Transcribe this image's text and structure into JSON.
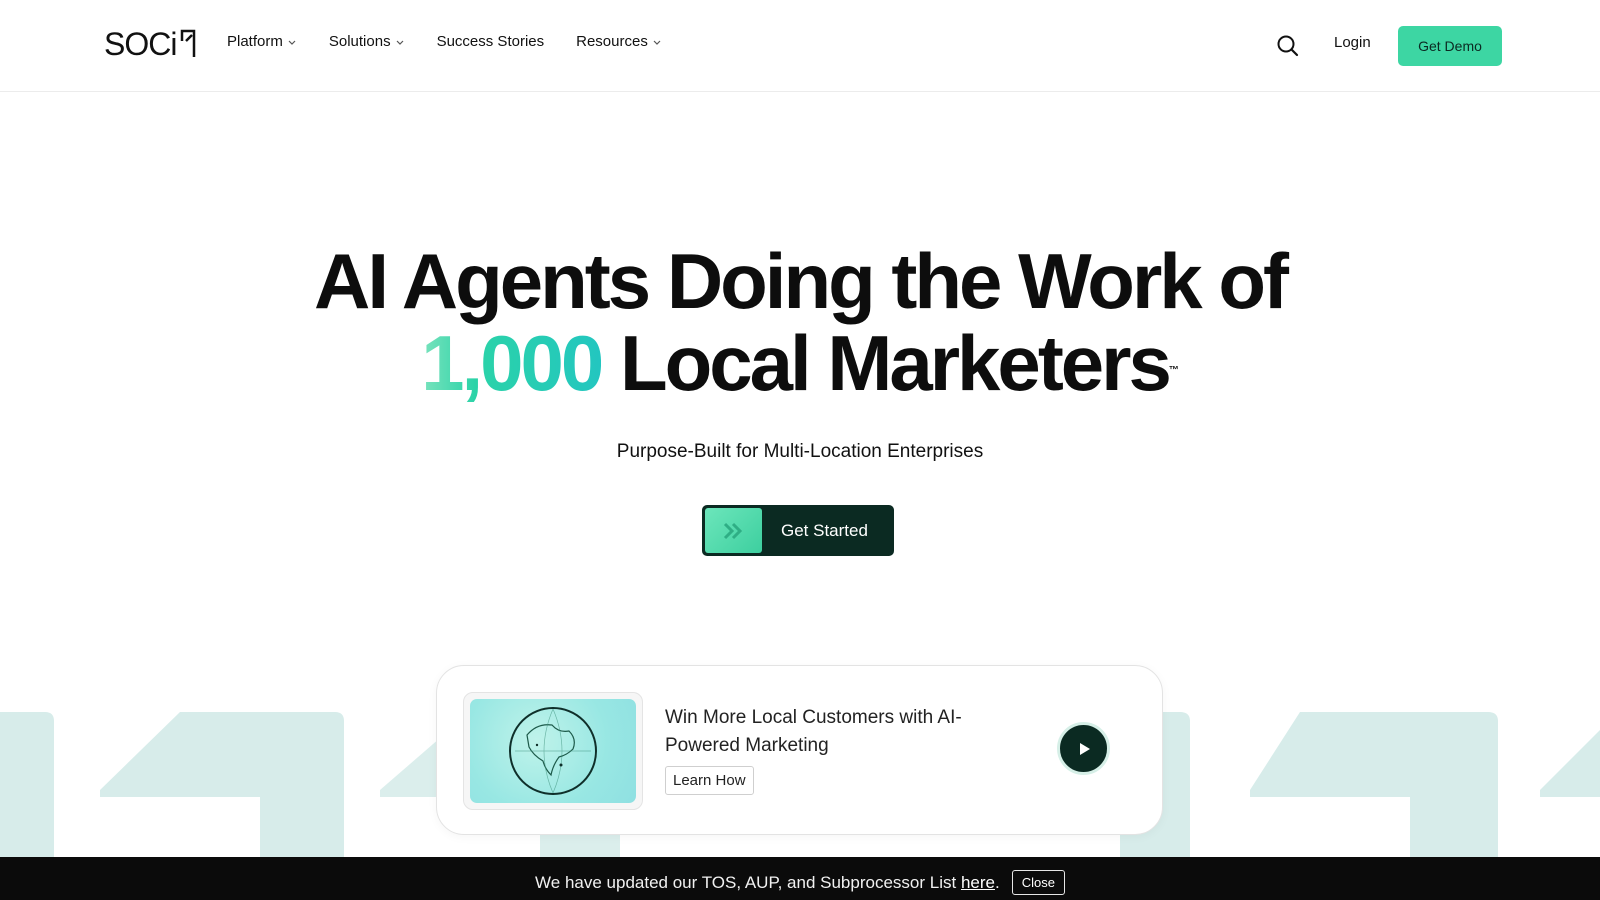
{
  "brand": {
    "logo_text": "SOCi",
    "accent_color": "#3dd6a3",
    "dark_color": "#0b2a22"
  },
  "nav": {
    "items": [
      {
        "label": "Platform",
        "has_dropdown": true
      },
      {
        "label": "Solutions",
        "has_dropdown": true
      },
      {
        "label": "Success Stories",
        "has_dropdown": false
      },
      {
        "label": "Resources",
        "has_dropdown": true
      }
    ],
    "search_icon": "search-icon",
    "login_label": "Login",
    "demo_label": "Get Demo"
  },
  "hero": {
    "title_line1": "AI Agents Doing the Work of",
    "title_accent": "1,000",
    "title_line2_rest": "Local Marketers",
    "trademark": "™",
    "subtitle": "Purpose-Built for Multi-Location Enterprises",
    "cta_label": "Get Started",
    "cta_icon": "double-chevron-right-icon"
  },
  "promo_card": {
    "title": "Win More Local Customers with AI-Powered Marketing",
    "button_label": "Learn How",
    "thumbnail_icon": "globe-icon",
    "play_icon": "play-icon"
  },
  "banner": {
    "text_before": "We have updated our TOS, AUP, and Subprocessor List ",
    "link_label": "here",
    "text_after": ".",
    "close_label": "Close"
  }
}
